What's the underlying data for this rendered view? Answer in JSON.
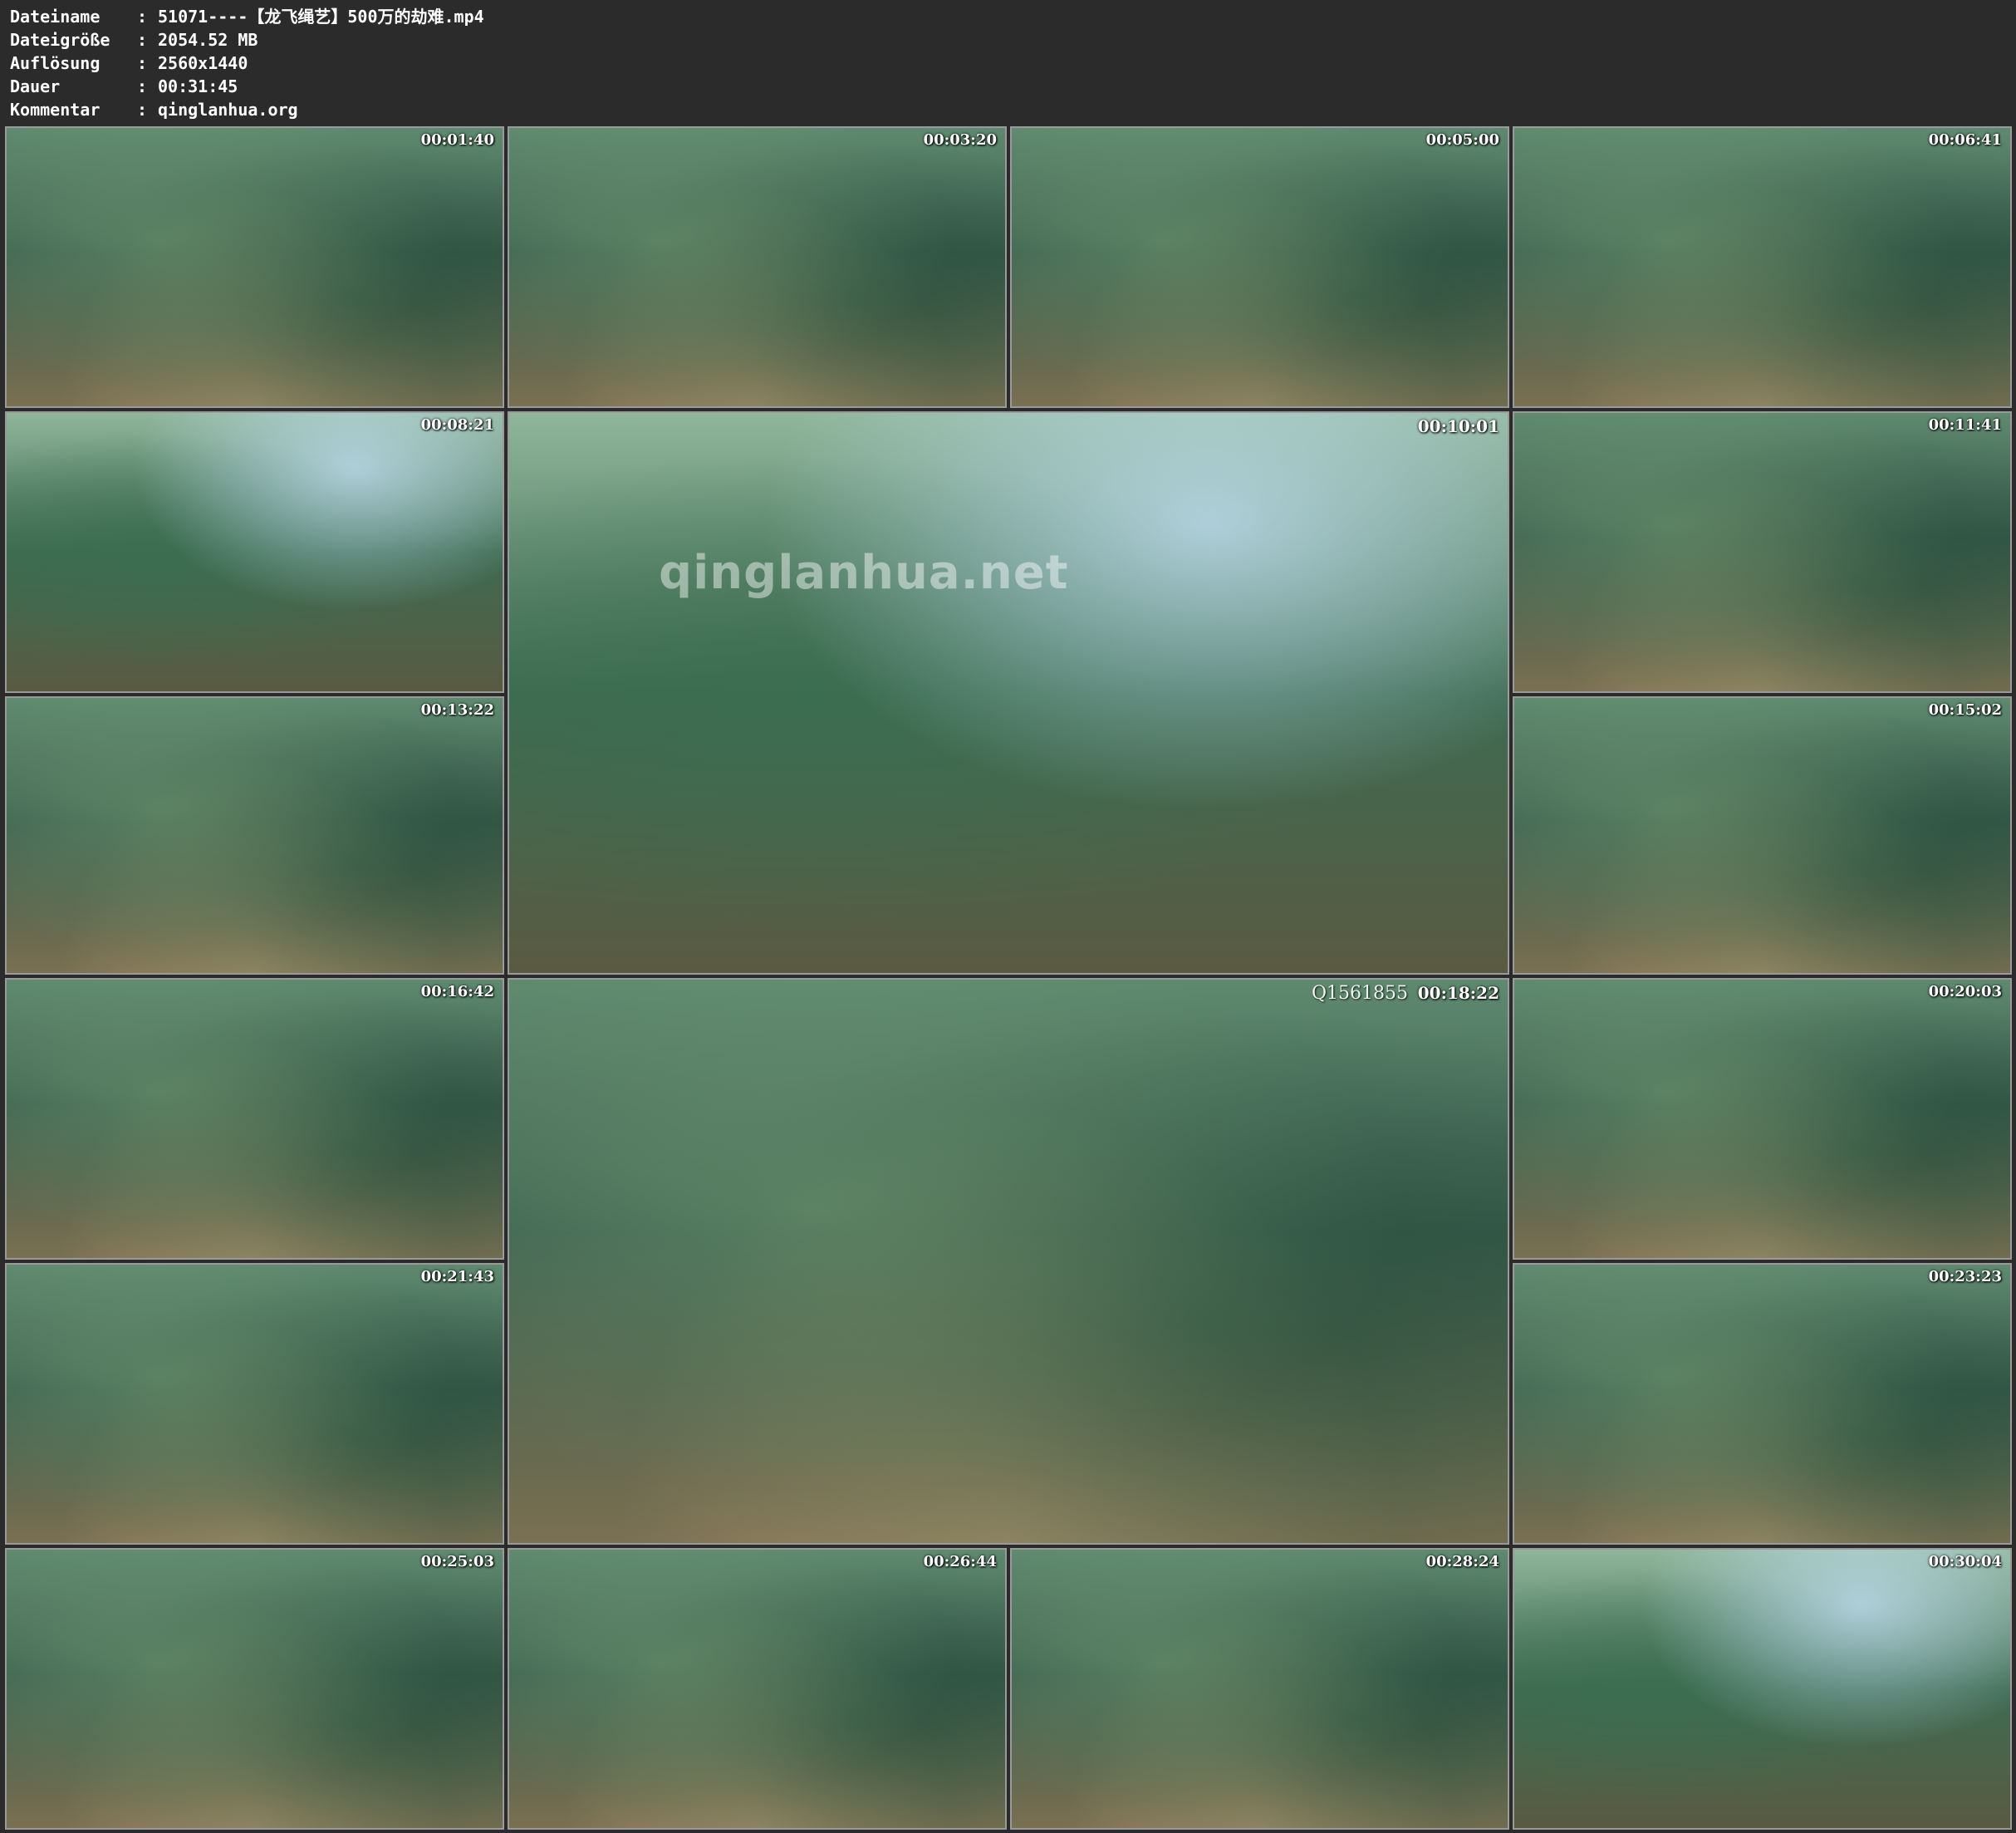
{
  "info": {
    "rows": [
      {
        "key": "Dateiname",
        "sep": ":",
        "value": "51071----【龙飞绳艺】500万的劫难.mp4"
      },
      {
        "key": "Dateigröße",
        "sep": ":",
        "value": "2054.52 MB"
      },
      {
        "key": "Auflösung",
        "sep": ":",
        "value": "2560x1440"
      },
      {
        "key": "Dauer",
        "sep": ":",
        "value": "00:31:45"
      },
      {
        "key": "Kommentar",
        "sep": ":",
        "value": "qinglanhua.org"
      }
    ]
  },
  "thumbnails": [
    {
      "timestamp": "00:01:40"
    },
    {
      "timestamp": "00:03:20"
    },
    {
      "timestamp": "00:05:00"
    },
    {
      "timestamp": "00:06:41"
    },
    {
      "timestamp": "00:08:21"
    },
    {
      "timestamp": "00:10:01",
      "watermark": "qinglanhua.net"
    },
    {
      "timestamp": "00:11:41"
    },
    {
      "timestamp": "00:13:22"
    },
    {
      "timestamp": "00:15:02"
    },
    {
      "timestamp": "00:16:42"
    },
    {
      "timestamp": "00:18:22",
      "watermark": "Q1561855"
    },
    {
      "timestamp": "00:20:03"
    },
    {
      "timestamp": "00:21:43"
    },
    {
      "timestamp": "00:23:23"
    },
    {
      "timestamp": "00:25:03"
    },
    {
      "timestamp": "00:26:44"
    },
    {
      "timestamp": "00:28:24"
    },
    {
      "timestamp": "00:30:04"
    }
  ]
}
